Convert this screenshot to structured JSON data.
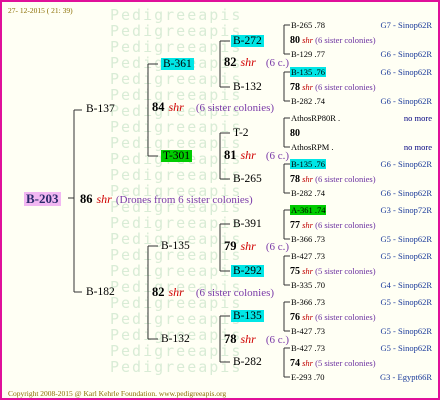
{
  "header": {
    "date": "27- 12-2015 ( 21: 39)"
  },
  "footer": {
    "copyright": "Copyright 2008-2015 @ Karl Kehrle Foundation.   www.pedigreeapis.org"
  },
  "watermark": {
    "text": "Pedigreeapis"
  },
  "colors": {
    "border": "#e0109a",
    "cyan": "#00e6e6",
    "green": "#00cc00",
    "root": "#f2b7f2",
    "red": "#d00000",
    "purple": "#7a3aa8",
    "blue": "#1a3a9a"
  },
  "root": {
    "label": "B-203",
    "num": "86",
    "shr": "shr",
    "note": "(Drones from 6 sister colonies)"
  },
  "gen1": [
    {
      "label": "B-137",
      "num": "84",
      "shr": "shr",
      "note": "(6 sister colonies)"
    },
    {
      "label": "B-182",
      "num": "82",
      "shr": "shr",
      "note": "(6 sister colonies)"
    }
  ],
  "gen2": [
    {
      "label": "B-361",
      "num": "82",
      "shr": "shr",
      "note": "(6 c.)"
    },
    {
      "label": "T-301",
      "num": "81",
      "shr": "shr",
      "note": "(6 c.)"
    },
    {
      "label": "B-135",
      "num": "79",
      "shr": "shr",
      "note": "(6 c.)"
    },
    {
      "label": "B-132",
      "num": "78",
      "shr": "shr",
      "note": "(6 c.)"
    }
  ],
  "gen3": [
    "B-272",
    "B-132",
    "T-2",
    "B-265",
    "B-391",
    "B-292",
    "B-135",
    "B-282"
  ],
  "rows": [
    {
      "left": "B-265 .78",
      "right": "G7 - Sinop62R"
    },
    {
      "num": "80",
      "shr": "shr",
      "note": "(6 sister colonies)"
    },
    {
      "left": "B-129 .77",
      "right": "G6 - Sinop62R"
    },
    {
      "left": "B-135 .76",
      "right": "G6 - Sinop62R"
    },
    {
      "num": "78",
      "shr": "shr",
      "note": "(6 sister colonies)"
    },
    {
      "left": "B-282 .74",
      "right": "G6 - Sinop62R"
    },
    {
      "left": "AthosRP80R .",
      "right": "no more"
    },
    {
      "num": "80"
    },
    {
      "left": "AthosRPM .",
      "right": "no more"
    },
    {
      "left": "B-135 .76",
      "right": "G6 - Sinop62R"
    },
    {
      "num": "78",
      "shr": "shr",
      "note": "(6 sister colonies)"
    },
    {
      "left": "B-282 .74",
      "right": "G6 - Sinop62R"
    },
    {
      "left": "A-361 .74",
      "right": "G3 - Sinop72R"
    },
    {
      "num": "77",
      "shr": "shr",
      "note": "(6 sister colonies)"
    },
    {
      "left": "B-366 .73",
      "right": "G5 - Sinop62R"
    },
    {
      "left": "B-427 .73",
      "right": "G5 - Sinop62R"
    },
    {
      "num": "75",
      "shr": "shr",
      "note": "(5 sister colonies)"
    },
    {
      "left": "B-335 .70",
      "right": "G4 - Sinop62R"
    },
    {
      "left": "B-366 .73",
      "right": "G5 - Sinop62R"
    },
    {
      "num": "76",
      "shr": "shr",
      "note": "(6 sister colonies)"
    },
    {
      "left": "B-427 .73",
      "right": "G5 - Sinop62R"
    },
    {
      "left": "B-427 .73",
      "right": "G5 - Sinop62R"
    },
    {
      "num": "74",
      "shr": "shr",
      "note": "(5 sister colonies)"
    },
    {
      "left": "E-293 .70",
      "right": "G3 - Egypt66R"
    }
  ]
}
